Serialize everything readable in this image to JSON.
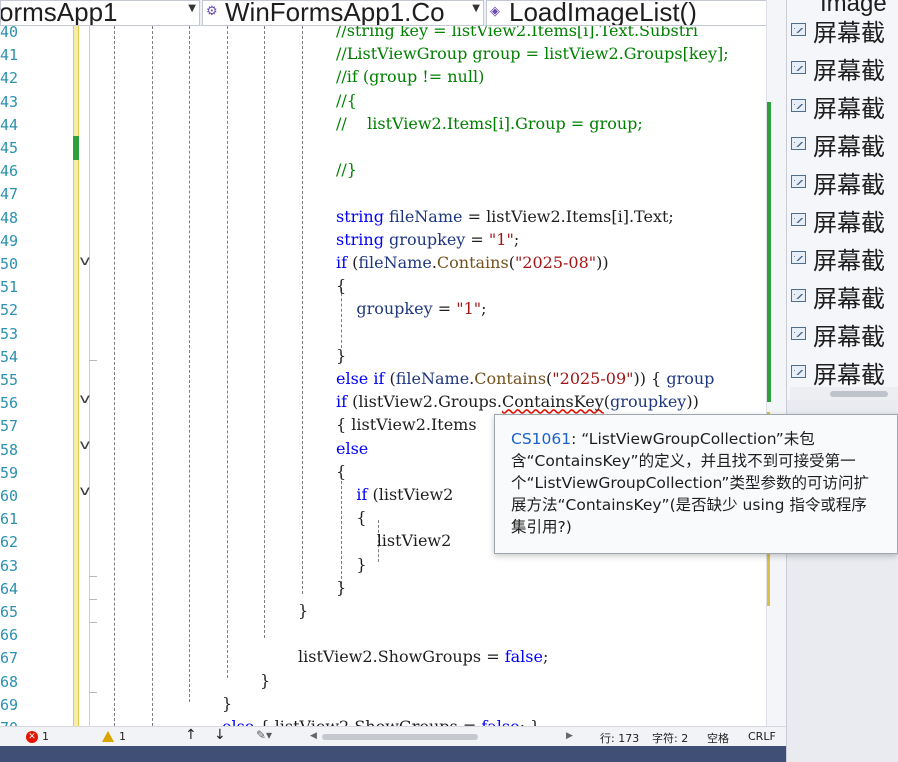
{
  "nav": {
    "project": "ormsApp1",
    "class": "WinFormsApp1.Co",
    "method": "LoadImageList()"
  },
  "editor": {
    "lines": [
      {
        "n": "40",
        "segments": [
          {
            "cls": "c",
            "text": "//string key = listView2.Items[i].Text.Substri"
          }
        ]
      },
      {
        "n": "41",
        "segments": [
          {
            "cls": "c",
            "text": "//ListViewGroup group = listView2.Groups[key];"
          }
        ]
      },
      {
        "n": "42",
        "segments": [
          {
            "cls": "c",
            "text": "//if (group != null)"
          }
        ]
      },
      {
        "n": "43",
        "segments": [
          {
            "cls": "c",
            "text": "//{"
          }
        ]
      },
      {
        "n": "44",
        "segments": [
          {
            "cls": "c",
            "text": "//    listView2.Items[i].Group = group;"
          }
        ]
      },
      {
        "n": "45",
        "segments": []
      },
      {
        "n": "46",
        "segments": [
          {
            "cls": "c",
            "text": "//}"
          }
        ]
      },
      {
        "n": "47",
        "segments": []
      },
      {
        "n": "48",
        "segments": [
          {
            "cls": "k",
            "text": "string"
          },
          {
            "cls": "",
            "text": " "
          },
          {
            "cls": "v",
            "text": "fileName"
          },
          {
            "cls": "",
            "text": " = listView2.Items[i].Text;"
          }
        ]
      },
      {
        "n": "49",
        "segments": [
          {
            "cls": "k",
            "text": "string"
          },
          {
            "cls": "",
            "text": " "
          },
          {
            "cls": "v",
            "text": "groupkey"
          },
          {
            "cls": "",
            "text": " = "
          },
          {
            "cls": "s",
            "text": "\"1\""
          },
          {
            "cls": "",
            "text": ";"
          }
        ]
      },
      {
        "n": "50",
        "segments": [
          {
            "cls": "k",
            "text": "if"
          },
          {
            "cls": "",
            "text": " ("
          },
          {
            "cls": "v",
            "text": "fileName"
          },
          {
            "cls": "",
            "text": "."
          },
          {
            "cls": "m",
            "text": "Contains"
          },
          {
            "cls": "",
            "text": "("
          },
          {
            "cls": "s",
            "text": "\"2025-08\""
          },
          {
            "cls": "",
            "text": "))"
          }
        ]
      },
      {
        "n": "51",
        "segments": [
          {
            "cls": "",
            "text": "{"
          }
        ]
      },
      {
        "n": "52",
        "segments": [
          {
            "cls": "",
            "text": "    "
          },
          {
            "cls": "v",
            "text": "groupkey"
          },
          {
            "cls": "",
            "text": " = "
          },
          {
            "cls": "s",
            "text": "\"1\""
          },
          {
            "cls": "",
            "text": ";"
          }
        ]
      },
      {
        "n": "53",
        "segments": []
      },
      {
        "n": "54",
        "segments": [
          {
            "cls": "",
            "text": "}"
          }
        ]
      },
      {
        "n": "55",
        "segments": [
          {
            "cls": "k",
            "text": "else if"
          },
          {
            "cls": "",
            "text": " ("
          },
          {
            "cls": "v",
            "text": "fileName"
          },
          {
            "cls": "",
            "text": "."
          },
          {
            "cls": "m",
            "text": "Contains"
          },
          {
            "cls": "",
            "text": "("
          },
          {
            "cls": "s",
            "text": "\"2025-09\""
          },
          {
            "cls": "",
            "text": ")) { "
          },
          {
            "cls": "v",
            "text": "group"
          }
        ]
      },
      {
        "n": "56",
        "segments": [
          {
            "cls": "k",
            "text": "if"
          },
          {
            "cls": "",
            "text": " (listView2.Groups."
          },
          {
            "cls": "squiggle",
            "text": "ContainsKey"
          },
          {
            "cls": "",
            "text": "("
          },
          {
            "cls": "v",
            "text": "groupkey"
          },
          {
            "cls": "",
            "text": "))"
          }
        ]
      },
      {
        "n": "57",
        "segments": [
          {
            "cls": "",
            "text": "{ listView2.Items"
          }
        ]
      },
      {
        "n": "58",
        "segments": [
          {
            "cls": "k",
            "text": "else"
          }
        ]
      },
      {
        "n": "59",
        "segments": [
          {
            "cls": "",
            "text": "{"
          }
        ]
      },
      {
        "n": "60",
        "segments": [
          {
            "cls": "",
            "text": "    "
          },
          {
            "cls": "k",
            "text": "if"
          },
          {
            "cls": "",
            "text": " (listView2"
          }
        ]
      },
      {
        "n": "61",
        "segments": [
          {
            "cls": "",
            "text": "    {"
          }
        ]
      },
      {
        "n": "62",
        "segments": [
          {
            "cls": "",
            "text": "        listView2"
          }
        ]
      },
      {
        "n": "63",
        "segments": [
          {
            "cls": "",
            "text": "    }"
          }
        ]
      },
      {
        "n": "64",
        "segments": [
          {
            "cls": "",
            "text": "}"
          }
        ]
      },
      {
        "n": "65",
        "segments": [
          {
            "cls": "",
            "text": "}"
          }
        ]
      },
      {
        "n": "66",
        "segments": []
      },
      {
        "n": "67",
        "segments": [
          {
            "cls": "",
            "text": "listView2.ShowGroups = "
          },
          {
            "cls": "k",
            "text": "false"
          },
          {
            "cls": "",
            "text": ";"
          }
        ]
      },
      {
        "n": "68",
        "segments": [
          {
            "cls": "",
            "text": "}"
          }
        ]
      },
      {
        "n": "69",
        "segments": [
          {
            "cls": "",
            "text": "}"
          }
        ]
      },
      {
        "n": "70",
        "segments": [
          {
            "cls": "k",
            "text": "else"
          },
          {
            "cls": "",
            "text": " { listView2.ShowGroups = "
          },
          {
            "cls": "k",
            "text": "false"
          },
          {
            "cls": "",
            "text": "; }"
          }
        ]
      }
    ]
  },
  "tooltip": {
    "error_code": "CS1061",
    "message": ": “ListViewGroupCollection”未包含“ContainsKey”的定义，并且找不到可接受第一个“ListViewGroupCollection”类型参数的可访问扩展方法“ContainsKey”(是否缺少 using 指令或程序集引用?)"
  },
  "solution_panel": {
    "header": "Image",
    "items": [
      "屏幕截",
      "屏幕截",
      "屏幕截",
      "屏幕截",
      "屏幕截",
      "屏幕截",
      "屏幕截",
      "屏幕截",
      "屏幕截",
      "屏幕截"
    ]
  },
  "status": {
    "errors": "1",
    "warnings": "1",
    "line": "行: 173",
    "char": "字符: 2",
    "spacing": "空格",
    "eol": "CRLF"
  },
  "colors": {
    "comment": "#008000",
    "keyword": "#0000ff",
    "string": "#a31515",
    "error": "#e51400",
    "accent": "#1a62c9"
  }
}
